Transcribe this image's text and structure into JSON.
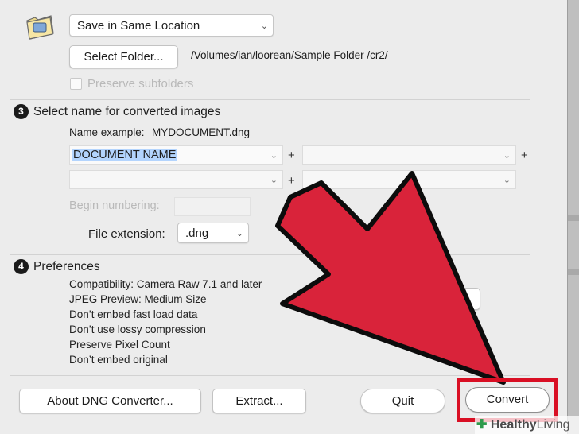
{
  "location": {
    "dropdown_value": "Save in Same Location",
    "select_folder_label": "Select Folder...",
    "folder_path": "/Volumes/ian/loorean/Sample Folder /cr2/",
    "preserve_subfolders_label": "Preserve subfolders"
  },
  "naming": {
    "section_number": "3",
    "section_title": "Select name for converted images",
    "name_example_label": "Name example:",
    "name_example_value": "MYDOCUMENT.dng",
    "field1_value": "DOCUMENT NAME",
    "plus": "+",
    "begin_numbering_label": "Begin numbering:",
    "file_extension_label": "File extension:",
    "file_extension_value": ".dng"
  },
  "preferences": {
    "section_number": "4",
    "section_title": "Preferences",
    "items": [
      "Compatibility: Camera Raw 7.1 and later",
      "JPEG Preview: Medium Size",
      "Don’t embed fast load data",
      "Don’t use lossy compression",
      "Preserve Pixel Count",
      "Don’t embed original"
    ]
  },
  "buttons": {
    "about": "About DNG Converter...",
    "extract": "Extract...",
    "quit": "Quit",
    "convert": "Convert"
  },
  "watermark": {
    "brand_prefix": "Healthy",
    "brand_suffix": "Living"
  },
  "colors": {
    "arrow_fill": "#d9233a",
    "highlight_border": "#d90f24",
    "selection": "#b3d4fd"
  }
}
